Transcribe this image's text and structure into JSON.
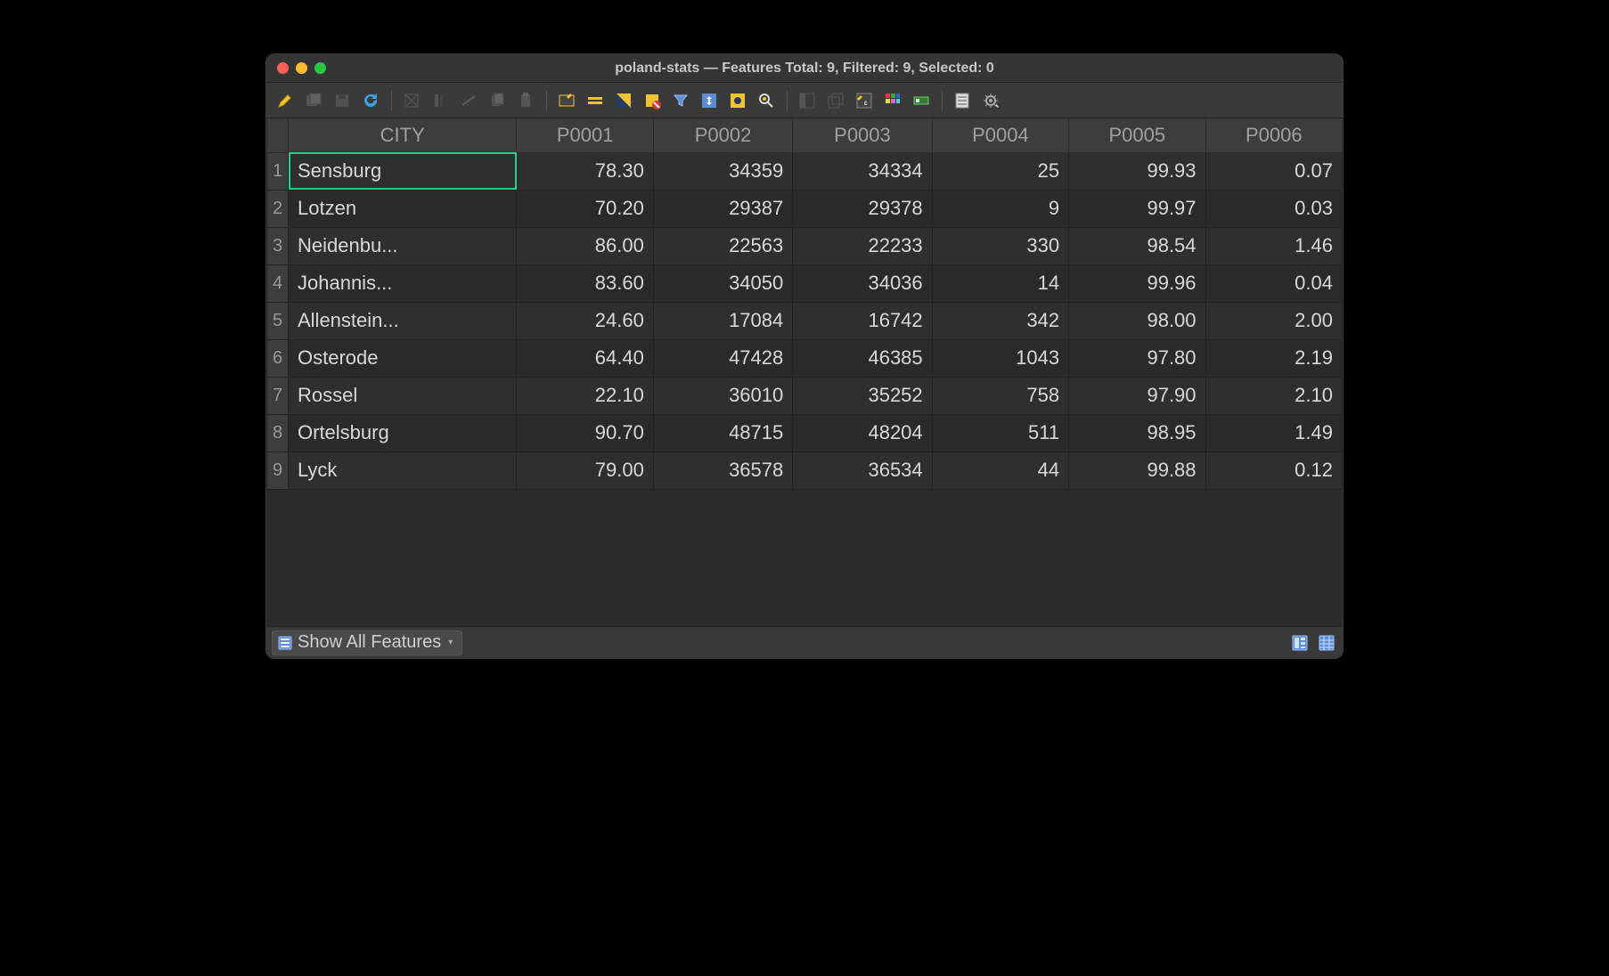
{
  "window": {
    "title": "poland-stats — Features Total: 9, Filtered: 9, Selected: 0"
  },
  "toolbar_icons": [
    "pencil",
    "multiedit",
    "save",
    "refresh",
    "|",
    "cut",
    "delete-column",
    "line",
    "copy",
    "paste",
    "|",
    "new-field",
    "equals",
    "invert",
    "deselect",
    "filter",
    "pan-to",
    "highlight",
    "zoom-to",
    "|",
    "dock",
    "undock",
    "field-calc",
    "conditional-format",
    "action",
    "|",
    "form",
    "settings"
  ],
  "table": {
    "columns": [
      "CITY",
      "P0001",
      "P0002",
      "P0003",
      "P0004",
      "P0005",
      "P0006"
    ],
    "rows": [
      {
        "n": 1,
        "CITY": "Sensburg",
        "P0001": "78.30",
        "P0002": "34359",
        "P0003": "34334",
        "P0004": "25",
        "P0005": "99.93",
        "P0006": "0.07"
      },
      {
        "n": 2,
        "CITY": "Lotzen",
        "P0001": "70.20",
        "P0002": "29387",
        "P0003": "29378",
        "P0004": "9",
        "P0005": "99.97",
        "P0006": "0.03"
      },
      {
        "n": 3,
        "CITY": "Neidenbu...",
        "P0001": "86.00",
        "P0002": "22563",
        "P0003": "22233",
        "P0004": "330",
        "P0005": "98.54",
        "P0006": "1.46"
      },
      {
        "n": 4,
        "CITY": "Johannis...",
        "P0001": "83.60",
        "P0002": "34050",
        "P0003": "34036",
        "P0004": "14",
        "P0005": "99.96",
        "P0006": "0.04"
      },
      {
        "n": 5,
        "CITY": "Allenstein...",
        "P0001": "24.60",
        "P0002": "17084",
        "P0003": "16742",
        "P0004": "342",
        "P0005": "98.00",
        "P0006": "2.00"
      },
      {
        "n": 6,
        "CITY": "Osterode",
        "P0001": "64.40",
        "P0002": "47428",
        "P0003": "46385",
        "P0004": "1043",
        "P0005": "97.80",
        "P0006": "2.19"
      },
      {
        "n": 7,
        "CITY": "Rossel",
        "P0001": "22.10",
        "P0002": "36010",
        "P0003": "35252",
        "P0004": "758",
        "P0005": "97.90",
        "P0006": "2.10"
      },
      {
        "n": 8,
        "CITY": "Ortelsburg",
        "P0001": "90.70",
        "P0002": "48715",
        "P0003": "48204",
        "P0004": "511",
        "P0005": "98.95",
        "P0006": "1.49"
      },
      {
        "n": 9,
        "CITY": "Lyck",
        "P0001": "79.00",
        "P0002": "36578",
        "P0003": "36534",
        "P0004": "44",
        "P0005": "99.88",
        "P0006": "0.12"
      }
    ],
    "selected_cell": {
      "row": 0,
      "col": "CITY"
    }
  },
  "statusbar": {
    "show_all_label": "Show All Features"
  }
}
